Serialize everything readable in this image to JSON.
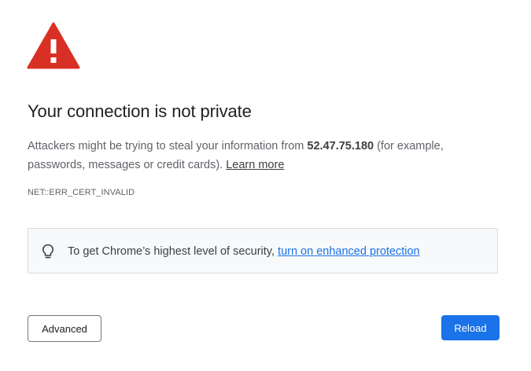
{
  "page": {
    "title": "Your connection is not private",
    "message": {
      "prefix": "Attackers might be trying to steal your information from ",
      "host": "52.47.75.180",
      "suffix": " (for example, passwords, messages or credit cards). ",
      "learn_more": "Learn more"
    },
    "error_code": "NET::ERR_CERT_INVALID",
    "enhanced_protection": {
      "icon": "lightbulb-icon",
      "text": "To get Chrome’s highest level of security, ",
      "link": "turn on enhanced protection"
    },
    "buttons": {
      "advanced": "Advanced",
      "reload": "Reload"
    }
  },
  "colors": {
    "warning_red": "#d93025",
    "link_blue": "#1a73e8",
    "primary_button": "#1a73e8",
    "title_text": "#202124",
    "body_text": "#5f6368"
  },
  "icons": {
    "warning": "warning-triangle-icon",
    "tip": "lightbulb-icon"
  }
}
